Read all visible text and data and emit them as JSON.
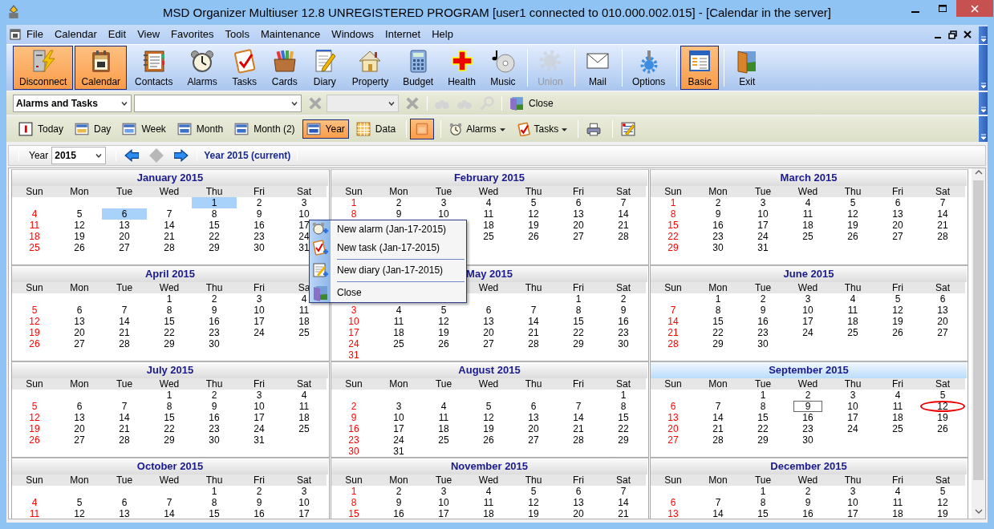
{
  "window": {
    "title": "MSD Organizer Multiuser 12.8 UNREGISTERED PROGRAM [user1 connected to 010.000.002.015] - [Calendar in the server]"
  },
  "menu_bar": [
    "File",
    "Calendar",
    "Edit",
    "View",
    "Favorites",
    "Tools",
    "Maintenance",
    "Windows",
    "Internet",
    "Help"
  ],
  "main_toolbar": [
    {
      "kind": "button",
      "label": "Disconnect",
      "selected": true,
      "disabled": false
    },
    {
      "kind": "button",
      "label": "Calendar",
      "selected": true,
      "disabled": false
    },
    {
      "kind": "button",
      "label": "Contacts",
      "selected": false,
      "disabled": false
    },
    {
      "kind": "button",
      "label": "Alarms",
      "selected": false,
      "disabled": false
    },
    {
      "kind": "button",
      "label": "Tasks",
      "selected": false,
      "disabled": false
    },
    {
      "kind": "button",
      "label": "Cards",
      "selected": false,
      "disabled": false
    },
    {
      "kind": "button",
      "label": "Diary",
      "selected": false,
      "disabled": false
    },
    {
      "kind": "button",
      "label": "Property",
      "selected": false,
      "disabled": false
    },
    {
      "kind": "button",
      "label": "Budget",
      "selected": false,
      "disabled": false
    },
    {
      "kind": "button",
      "label": "Health",
      "selected": false,
      "disabled": false
    },
    {
      "kind": "button",
      "label": "Music",
      "selected": false,
      "disabled": false
    },
    {
      "kind": "separator"
    },
    {
      "kind": "button",
      "label": "Union",
      "selected": false,
      "disabled": true
    },
    {
      "kind": "separator"
    },
    {
      "kind": "button",
      "label": "Mail",
      "selected": false,
      "disabled": false
    },
    {
      "kind": "separator"
    },
    {
      "kind": "button",
      "label": "Options",
      "selected": false,
      "disabled": false
    },
    {
      "kind": "separator"
    },
    {
      "kind": "button",
      "label": "Basic",
      "selected": true,
      "disabled": false
    },
    {
      "kind": "separator"
    },
    {
      "kind": "button",
      "label": "Exit",
      "selected": false,
      "disabled": false
    }
  ],
  "filter_toolbar": [
    {
      "kind": "dropdown",
      "value": "Alarms and Tasks",
      "disabled": false
    },
    {
      "kind": "combo",
      "disabled": false
    },
    {
      "kind": "clear",
      "disabled": true
    },
    {
      "kind": "combo",
      "disabled": true
    },
    {
      "kind": "clear",
      "disabled": true
    },
    {
      "kind": "separator"
    },
    {
      "kind": "find",
      "disabled": true
    },
    {
      "kind": "find",
      "disabled": true
    },
    {
      "kind": "zoom",
      "disabled": true
    },
    {
      "kind": "separator"
    },
    {
      "kind": "button",
      "label": "Close",
      "disabled": false
    }
  ],
  "view_toolbar": [
    {
      "kind": "button",
      "label": "Today",
      "selected": false
    },
    {
      "kind": "button",
      "label": "Day",
      "selected": false
    },
    {
      "kind": "button",
      "label": "Week",
      "selected": false
    },
    {
      "kind": "button",
      "label": "Month",
      "selected": false
    },
    {
      "kind": "button",
      "label": "Month (2)",
      "selected": false
    },
    {
      "kind": "button",
      "label": "Year",
      "selected": true
    },
    {
      "kind": "button",
      "label": "Data",
      "selected": false
    },
    {
      "kind": "separator"
    },
    {
      "kind": "icon_button",
      "selected": true
    },
    {
      "kind": "separator"
    },
    {
      "kind": "dropdown",
      "label": "Alarms",
      "selected": false
    },
    {
      "kind": "dropdown",
      "label": "Tasks",
      "selected": false
    },
    {
      "kind": "separator"
    },
    {
      "kind": "icon_button",
      "selected": false
    },
    {
      "kind": "separator"
    },
    {
      "kind": "icon_button",
      "selected": false
    }
  ],
  "year_nav": {
    "label": "Year",
    "year": "2015",
    "heading": "Year 2015 (current)"
  },
  "months": [
    {
      "title": "January 2015",
      "current": false,
      "weekdays": [
        "Sun",
        "Mon",
        "Tue",
        "Wed",
        "Thu",
        "Fri",
        "Sat"
      ],
      "weeks": [
        [
          {
            "day": "1",
            "kind": "highlight"
          },
          "2",
          "3"
        ],
        [
          "4",
          "5",
          {
            "day": "6",
            "kind": "highlight"
          },
          "7",
          "8",
          "9",
          "10"
        ],
        [
          "11",
          "12",
          "13",
          "14",
          "15",
          "16",
          "17"
        ],
        [
          "18",
          "19",
          "20",
          "21",
          "22",
          "23",
          "24"
        ],
        [
          "25",
          "26",
          "27",
          "28",
          "29",
          "30",
          "31"
        ]
      ]
    },
    {
      "title": "February 2015",
      "current": false,
      "weekdays": [
        "Sun",
        "Mon",
        "Tue",
        "Wed",
        "Thu",
        "Fri",
        "Sat"
      ],
      "weeks": [
        [
          "1",
          "2",
          "3",
          "4",
          "5",
          "6",
          "7"
        ],
        [
          "8",
          "9",
          "10",
          "11",
          "12",
          "13",
          "14"
        ],
        {
          "days": [
            "18",
            "19",
            "20",
            "21"
          ],
          "flush_right": true
        },
        {
          "days": [
            "25",
            "26",
            "27",
            "28"
          ],
          "flush_right": true
        }
      ]
    },
    {
      "title": "March 2015",
      "current": false,
      "weekdays": [
        "Sun",
        "Mon",
        "Tue",
        "Wed",
        "Thu",
        "Fri",
        "Sat"
      ],
      "weeks": [
        [
          "1",
          "2",
          "3",
          "4",
          "5",
          "6",
          "7"
        ],
        [
          "8",
          "9",
          "10",
          "11",
          "12",
          "13",
          "14"
        ],
        [
          "15",
          "16",
          "17",
          "18",
          "19",
          "20",
          "21"
        ],
        [
          "22",
          "23",
          "24",
          "25",
          "26",
          "27",
          "28"
        ],
        [
          "29",
          "30",
          "31"
        ]
      ]
    },
    {
      "title": "April 2015",
      "current": false,
      "weekdays": [
        "Sun",
        "Mon",
        "Tue",
        "Wed",
        "Thu",
        "Fri",
        "Sa"
      ],
      "weeks": [
        [
          "1",
          "2",
          "3",
          "4"
        ],
        [
          "5",
          "6",
          "7",
          "8",
          "9",
          "10",
          "11"
        ],
        [
          "12",
          "13",
          "14",
          "15",
          "16",
          "17",
          "18"
        ],
        [
          "19",
          "20",
          "21",
          "22",
          "23",
          "24",
          "25"
        ],
        [
          "26",
          "27",
          "28",
          "29",
          "30"
        ]
      ]
    },
    {
      "title": "May 2015",
      "current": false,
      "weekdays": [
        "Wed",
        "Thu",
        "Fri",
        "Sat"
      ],
      "weeks": [
        [
          "1",
          "2"
        ],
        [
          "3",
          "4",
          "5",
          "6",
          "7",
          "8",
          "9"
        ],
        [
          "10",
          "11",
          "12",
          "13",
          "14",
          "15",
          "16"
        ],
        [
          "17",
          "18",
          "19",
          "20",
          "21",
          "22",
          "23"
        ],
        [
          "24",
          "25",
          "26",
          "27",
          "28",
          "29",
          "30"
        ],
        [
          "31"
        ]
      ]
    },
    {
      "title": "June 2015",
      "current": false,
      "weekdays": [
        "Sun",
        "Mon",
        "Tue",
        "Wed",
        "Thu",
        "Fri",
        "Sat"
      ],
      "weeks": [
        [
          "1",
          "2",
          "3",
          "4",
          "5",
          "6"
        ],
        [
          "7",
          "8",
          "9",
          "10",
          "11",
          "12",
          "13"
        ],
        [
          "14",
          "15",
          "16",
          "17",
          "18",
          "19",
          "20"
        ],
        [
          "21",
          "22",
          "23",
          "24",
          "25",
          "26",
          "27"
        ],
        [
          "28",
          "29",
          "30"
        ]
      ]
    },
    {
      "title": "July 2015",
      "current": false,
      "weekdays": [
        "Sun",
        "Mon",
        "Tue",
        "Wed",
        "Thu",
        "Fri",
        "Sat"
      ],
      "weeks": [
        [
          "1",
          "2",
          "3",
          "4"
        ],
        [
          "5",
          "6",
          "7",
          "8",
          "9",
          "10",
          "11"
        ],
        [
          "12",
          "13",
          "14",
          "15",
          "16",
          "17",
          "18"
        ],
        [
          "19",
          "20",
          "21",
          "22",
          "23",
          "24",
          "25"
        ],
        [
          "26",
          "27",
          "28",
          "29",
          "30",
          "31"
        ]
      ]
    },
    {
      "title": "August 2015",
      "current": false,
      "weekdays": [
        "Sun",
        "Mon",
        "Tue",
        "Wed",
        "Thu",
        "Fri",
        "Sat"
      ],
      "weeks": [
        [
          "1"
        ],
        [
          "2",
          "3",
          "4",
          "5",
          "6",
          "7",
          "8"
        ],
        [
          "9",
          "10",
          "11",
          "12",
          "13",
          "14",
          "15"
        ],
        [
          "16",
          "17",
          "18",
          "19",
          "20",
          "21",
          "22"
        ],
        [
          "23",
          "24",
          "25",
          "26",
          "27",
          "28",
          "29"
        ],
        [
          "30",
          "31"
        ]
      ]
    },
    {
      "title": "September 2015",
      "current": true,
      "weekdays": [
        "Sun",
        "Mon",
        "Tue",
        "Wed",
        "Thu",
        "Fri",
        "Sat"
      ],
      "weeks": [
        [
          "1",
          "2",
          "3",
          "4",
          "5"
        ],
        [
          "6",
          "7",
          "8",
          {
            "day": "9",
            "kind": "today"
          },
          "10",
          "11",
          {
            "day": "12",
            "kind": "circled"
          }
        ],
        [
          "13",
          "14",
          "15",
          "16",
          "17",
          "18",
          "19"
        ],
        [
          "20",
          "21",
          "22",
          "23",
          "24",
          "25",
          "26"
        ],
        [
          "27",
          "28",
          "29",
          "30"
        ]
      ]
    },
    {
      "title": "October 2015",
      "current": false,
      "weekdays": [
        "Sun",
        "Mon",
        "Tue",
        "Wed",
        "Thu",
        "Fri",
        "Sat"
      ],
      "weeks": [
        [
          "1",
          "2",
          "3"
        ],
        [
          "4",
          "5",
          "6",
          "7",
          "8",
          "9",
          "10"
        ],
        [
          "11",
          "12",
          "13",
          "14",
          "15",
          "16",
          "17"
        ]
      ]
    },
    {
      "title": "November 2015",
      "current": false,
      "weekdays": [
        "Sun",
        "Mon",
        "Tue",
        "Wed",
        "Thu",
        "Fri",
        "Sat"
      ],
      "weeks": [
        [
          "1",
          "2",
          "3",
          "4",
          "5",
          "6",
          "7"
        ],
        [
          "8",
          "9",
          "10",
          "11",
          "12",
          "13",
          "14"
        ],
        [
          "15",
          "16",
          "17",
          "18",
          "19",
          "20",
          "21"
        ]
      ]
    },
    {
      "title": "December 2015",
      "current": false,
      "weekdays": [
        "Sun",
        "Mon",
        "Tue",
        "Wed",
        "Thu",
        "Fri",
        "Sat"
      ],
      "weeks": [
        [
          "1",
          "2",
          "3",
          "4",
          "5"
        ],
        [
          "6",
          "7",
          "8",
          "9",
          "10",
          "11",
          "12"
        ],
        [
          "13",
          "14",
          "15",
          "16",
          "17",
          "18",
          "19"
        ]
      ]
    }
  ],
  "context_menu": [
    {
      "kind": "item",
      "label": "New alarm (Jan-17-2015)"
    },
    {
      "kind": "item",
      "label": "New task (Jan-17-2015)"
    },
    {
      "kind": "separator"
    },
    {
      "kind": "item",
      "label": "New diary (Jan-17-2015)"
    },
    {
      "kind": "separator"
    },
    {
      "kind": "item",
      "label": "Close"
    }
  ]
}
